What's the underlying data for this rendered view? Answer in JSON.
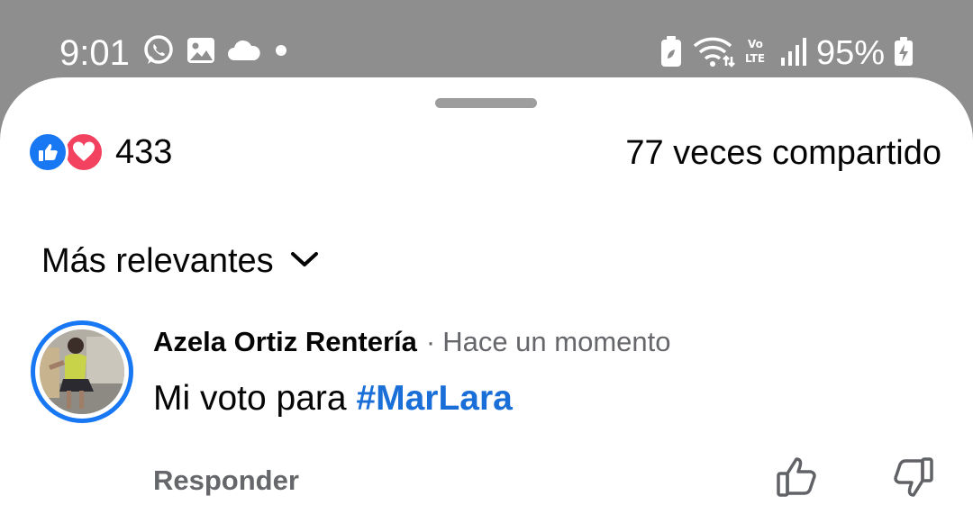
{
  "status_bar": {
    "time": "9:01",
    "left_icons": [
      "whatsapp-icon",
      "gallery-icon",
      "cloud-icon",
      "dot-icon"
    ],
    "right_icons": [
      "battery-saver-icon",
      "wifi-icon",
      "volte-icon",
      "signal-icon"
    ],
    "battery": "95%"
  },
  "post_stats": {
    "reaction_icons": [
      "like-reaction-icon",
      "love-reaction-icon"
    ],
    "reaction_count": "433",
    "shares": "77 veces compartido"
  },
  "sort": {
    "label": "Más relevantes"
  },
  "comment": {
    "author": "Azela Ortiz Rentería",
    "separator": "·",
    "time": "Hace un momento",
    "text": "Mi voto para ",
    "hashtag": "#MarLara",
    "reply_label": "Responder"
  },
  "colors": {
    "accent": "#1877f2",
    "hashtag": "#1a6ed8",
    "love": "#f3425f",
    "secondary_text": "#65676b",
    "status_bar_bg": "#8e8e8e"
  }
}
